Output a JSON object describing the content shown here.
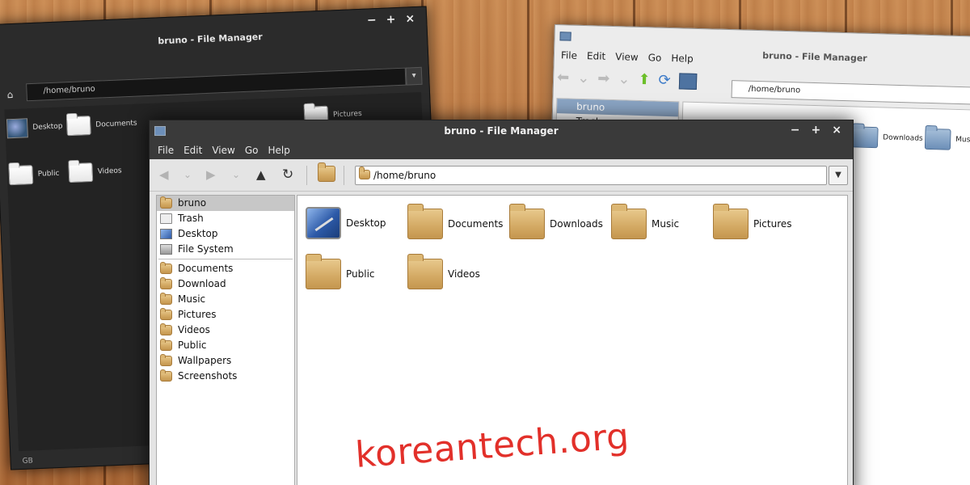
{
  "dark_window": {
    "title": "bruno - File Manager",
    "controls": {
      "minimize": "−",
      "maximize": "+",
      "close": "×"
    },
    "path": "/home/bruno",
    "items": [
      "Desktop",
      "Documents",
      "Pictures",
      "Public",
      "Videos"
    ],
    "status": "GB"
  },
  "light_window": {
    "title": "bruno - File Manager",
    "menu": [
      "File",
      "Edit",
      "View",
      "Go",
      "Help"
    ],
    "path": "/home/bruno",
    "sidebar": [
      "bruno",
      "Trash"
    ],
    "items": [
      "Downloads",
      "Music"
    ]
  },
  "front_window": {
    "title": "bruno - File Manager",
    "controls": {
      "minimize": "−",
      "maximize": "+",
      "close": "×"
    },
    "menu": [
      "File",
      "Edit",
      "View",
      "Go",
      "Help"
    ],
    "path": "/home/bruno",
    "sidebar_places": [
      {
        "label": "bruno",
        "icon": "home-icon",
        "selected": true
      },
      {
        "label": "Trash",
        "icon": "trash-icon"
      },
      {
        "label": "Desktop",
        "icon": "desktop-icon"
      },
      {
        "label": "File System",
        "icon": "drive-icon"
      }
    ],
    "sidebar_bookmarks": [
      "Documents",
      "Download",
      "Music",
      "Pictures",
      "Videos",
      "Public",
      "Wallpapers",
      "Screenshots"
    ],
    "items": [
      "Desktop",
      "Documents",
      "Downloads",
      "Music",
      "Pictures",
      "Public",
      "Videos"
    ]
  },
  "watermark": "koreantech.org"
}
